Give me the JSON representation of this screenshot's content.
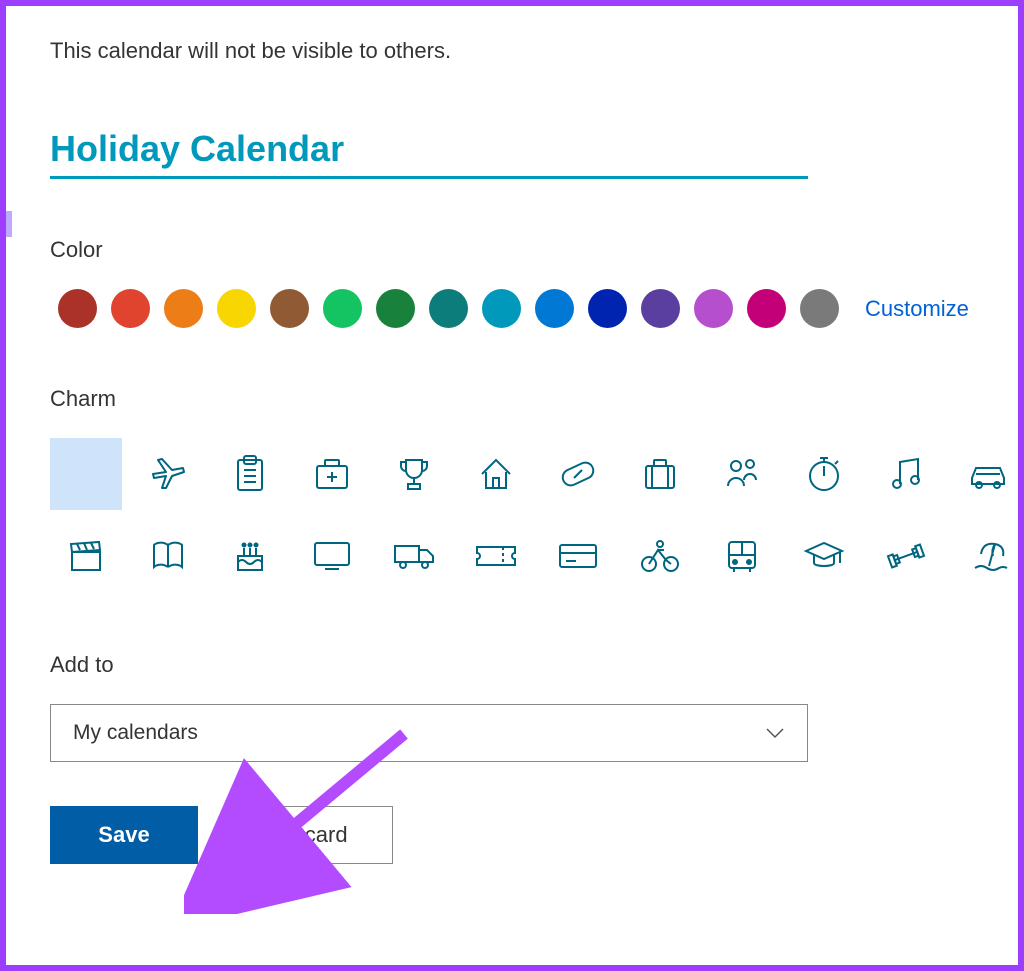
{
  "visibility_text": "This calendar will not be visible to others.",
  "calendar_title": "Holiday Calendar",
  "color": {
    "label": "Color",
    "swatches": [
      "#aa3228",
      "#e0442e",
      "#ed7d16",
      "#f7d602",
      "#8f5a34",
      "#14c362",
      "#18823c",
      "#0c7d7a",
      "#0099bc",
      "#0078d4",
      "#0024b0",
      "#5b3fa0",
      "#b54fce",
      "#c30078",
      "#7a7a7a"
    ],
    "customize_link": "Customize"
  },
  "charm": {
    "label": "Charm",
    "selected_index": 0,
    "icons": [
      "none",
      "airplane",
      "clipboard",
      "first-aid",
      "trophy",
      "home",
      "pill",
      "briefcase",
      "people",
      "stopwatch",
      "music",
      "car",
      "clapperboard",
      "book",
      "birthday",
      "monitor",
      "truck",
      "ticket",
      "credit-card",
      "cycling",
      "bus",
      "graduation",
      "dumbbell",
      "beach"
    ]
  },
  "add_to": {
    "label": "Add to",
    "selected": "My calendars"
  },
  "buttons": {
    "save": "Save",
    "discard": "Discard"
  }
}
